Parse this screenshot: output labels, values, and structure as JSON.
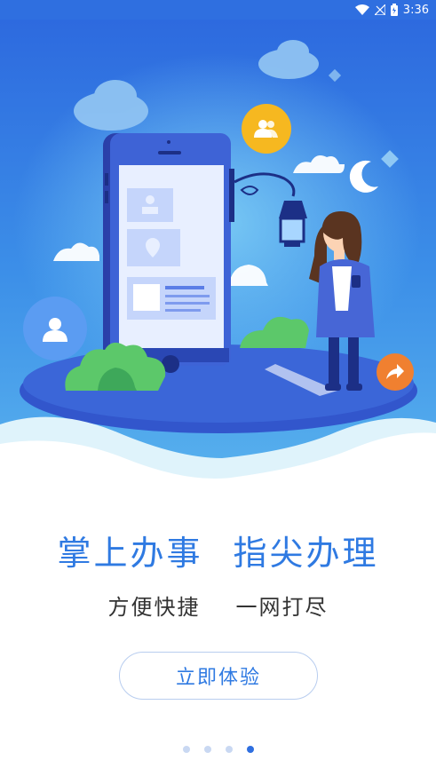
{
  "status_bar": {
    "time": "3:36",
    "icons": [
      "wifi-icon",
      "signal-off-icon",
      "battery-icon"
    ]
  },
  "hero": {
    "illustration": "phone-with-person-and-lamp",
    "icons": [
      "group-icon",
      "user-icon",
      "share-arrow-icon"
    ]
  },
  "headline": {
    "part1": "掌上办事",
    "part2": "指尖办理"
  },
  "subline": {
    "part1": "方便快捷",
    "part2": "一网打尽"
  },
  "cta": {
    "label": "立即体验"
  },
  "pager": {
    "count": 4,
    "active_index": 3
  },
  "colors": {
    "accent": "#2f7ae2",
    "status_bar": "#2f6fe0",
    "orange": "#f08030",
    "yellow": "#f6b820"
  }
}
